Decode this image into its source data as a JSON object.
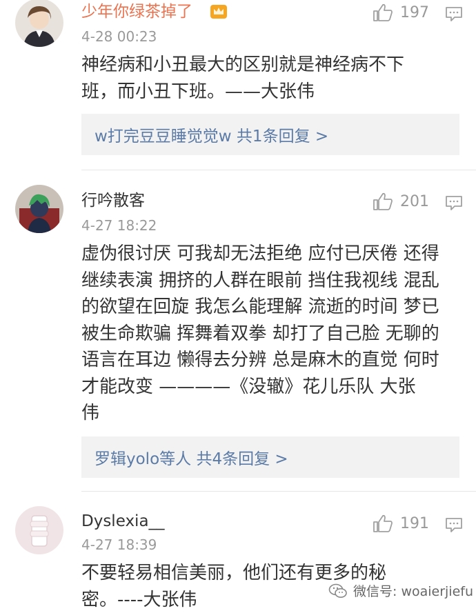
{
  "comments": [
    {
      "username": "少年你绿茶掉了",
      "time": "4-28 00:23",
      "likes": "197",
      "body_lines": [
        "神经病和小丑最大的区别就是神经病不下",
        "班，而小丑下班。——大张伟"
      ],
      "reply_summary": "w打完豆豆睡觉觉w  共1条回复 >"
    },
    {
      "username": "行吟散客",
      "time": "4-27 18:22",
      "likes": "201",
      "body_lines": [
        "虚伪很讨厌 可我却无法拒绝 应付已厌倦 还得",
        "继续表演 拥挤的人群在眼前 挡住我视线 混乱",
        "的欲望在回旋 我怎么能理解 流逝的时间 梦已",
        "被生命欺骗 挥舞着双拳 却打了自己脸 无聊的",
        "语言在耳边 懒得去分辨 总是麻木的直觉 何时",
        "才能改变   ————《没辙》花儿乐队   大张",
        "伟"
      ],
      "reply_summary": "罗辑yolo等人  共4条回复 >"
    },
    {
      "username": "Dyslexia__",
      "time": "4-27 18:39",
      "likes": "191",
      "body_lines": [
        "不要轻易相信美丽，他们还有更多的秘",
        "密。----大张伟"
      ]
    }
  ],
  "watermark": {
    "text": "微信号: woaierjiefu"
  },
  "colors": {
    "link": "#5b7ba6",
    "muted": "#999999",
    "reply_bg": "#f2f2f2",
    "vip_gold": "#f5a623"
  }
}
